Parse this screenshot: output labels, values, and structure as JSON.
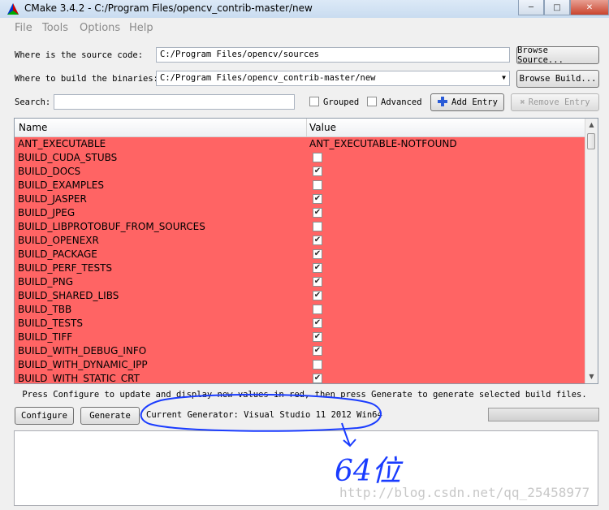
{
  "window": {
    "title": "CMake 3.4.2 - C:/Program Files/opencv_contrib-master/new"
  },
  "menu": [
    "File",
    "Tools",
    "Options",
    "Help"
  ],
  "source": {
    "label": "Where is the source code:",
    "value": "C:/Program Files/opencv/sources",
    "browse": "Browse Source..."
  },
  "build": {
    "label": "Where to build the binaries:",
    "value": "C:/Program Files/opencv_contrib-master/new",
    "browse": "Browse Build..."
  },
  "search": {
    "label": "Search:",
    "value": ""
  },
  "options": {
    "grouped": "Grouped",
    "advanced": "Advanced",
    "add_entry": "Add Entry",
    "remove_entry": "Remove Entry"
  },
  "table": {
    "headers": [
      "Name",
      "Value"
    ],
    "rows": [
      {
        "name": "ANT_EXECUTABLE",
        "type": "text",
        "value": "ANT_EXECUTABLE-NOTFOUND"
      },
      {
        "name": "BUILD_CUDA_STUBS",
        "type": "bool",
        "checked": false
      },
      {
        "name": "BUILD_DOCS",
        "type": "bool",
        "checked": true
      },
      {
        "name": "BUILD_EXAMPLES",
        "type": "bool",
        "checked": false
      },
      {
        "name": "BUILD_JASPER",
        "type": "bool",
        "checked": true
      },
      {
        "name": "BUILD_JPEG",
        "type": "bool",
        "checked": true
      },
      {
        "name": "BUILD_LIBPROTOBUF_FROM_SOURCES",
        "type": "bool",
        "checked": false
      },
      {
        "name": "BUILD_OPENEXR",
        "type": "bool",
        "checked": true
      },
      {
        "name": "BUILD_PACKAGE",
        "type": "bool",
        "checked": true
      },
      {
        "name": "BUILD_PERF_TESTS",
        "type": "bool",
        "checked": true
      },
      {
        "name": "BUILD_PNG",
        "type": "bool",
        "checked": true
      },
      {
        "name": "BUILD_SHARED_LIBS",
        "type": "bool",
        "checked": true
      },
      {
        "name": "BUILD_TBB",
        "type": "bool",
        "checked": false
      },
      {
        "name": "BUILD_TESTS",
        "type": "bool",
        "checked": true
      },
      {
        "name": "BUILD_TIFF",
        "type": "bool",
        "checked": true
      },
      {
        "name": "BUILD_WITH_DEBUG_INFO",
        "type": "bool",
        "checked": true
      },
      {
        "name": "BUILD_WITH_DYNAMIC_IPP",
        "type": "bool",
        "checked": false
      },
      {
        "name": "BUILD_WITH_STATIC_CRT",
        "type": "bool",
        "checked": true
      }
    ]
  },
  "hint": "Press Configure to update and display new values in red, then press Generate to generate selected build files.",
  "buttons": {
    "configure": "Configure",
    "generate": "Generate"
  },
  "generator": "Current Generator: Visual Studio 11 2012 Win64",
  "annotation": {
    "text": "64位"
  },
  "watermark": "http://blog.csdn.net/qq_25458977",
  "colors": {
    "changed_row": "#ff6464",
    "annotation_ink": "#1a3cff"
  }
}
